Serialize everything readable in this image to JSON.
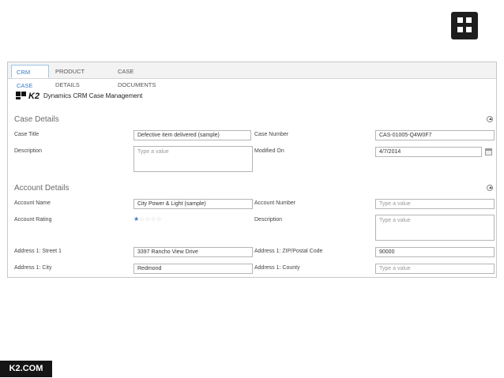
{
  "tabs": [
    {
      "label": "CRM CASE",
      "active": true
    },
    {
      "label": "PRODUCT DETAILS",
      "active": false
    },
    {
      "label": "CASE DOCUMENTS",
      "active": false
    }
  ],
  "brand": {
    "logo": "K2",
    "title": "Dynamics CRM Case Management"
  },
  "case_details": {
    "title": "Case Details",
    "case_title_label": "Case Title",
    "case_title_value": "Defective item delivered (sample)",
    "case_number_label": "Case Number",
    "case_number_value": "CAS-01005-Q4W0F7",
    "description_label": "Description",
    "description_placeholder": "Type a value",
    "modified_on_label": "Modified On",
    "modified_on_value": "4/7/2014"
  },
  "account_details": {
    "title": "Account Details",
    "account_name_label": "Account Name",
    "account_name_value": "City Power & Light (sample)",
    "account_number_label": "Account Number",
    "account_number_placeholder": "Type a value",
    "account_rating_label": "Account Rating",
    "account_rating_value": 1,
    "account_rating_max": 5,
    "description_label": "Description",
    "description_placeholder": "Type a value",
    "street1_label": "Address 1: Street 1",
    "street1_value": "3397 Rancho View Drive",
    "zip_label": "Address 1: ZIP/Postal Code",
    "zip_value": "90000",
    "city_label": "Address 1: City",
    "city_value": "Redmond",
    "county_label": "Address 1: County",
    "county_placeholder": "Type a value"
  },
  "footer": {
    "brand": "K2.COM"
  },
  "icons": {
    "corner": "k2-logo-icon",
    "collapse": "collapse-icon",
    "calendar": "calendar-icon",
    "star": "star-icon"
  },
  "colors": {
    "accent": "#3b7bbf",
    "dark": "#151515"
  }
}
